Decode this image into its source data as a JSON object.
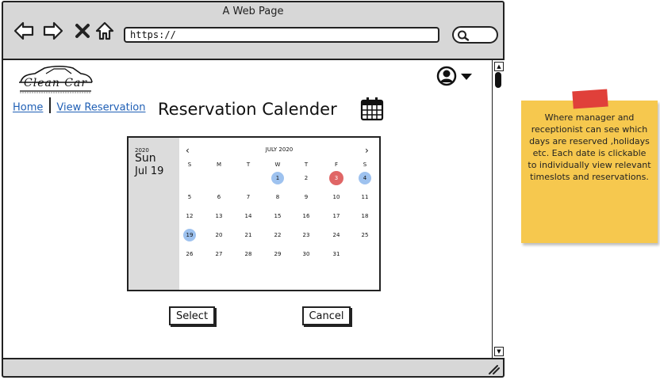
{
  "browser": {
    "title": "A Web Page",
    "url": "https://"
  },
  "icons": {
    "back": "arrow-left-icon",
    "forward": "arrow-right-icon",
    "stop": "close-icon",
    "home": "home-icon",
    "search": "search-icon",
    "user": "user-icon",
    "dropdown": "chevron-down-icon",
    "calendar": "calendar-icon"
  },
  "header": {
    "logo_text": "Clean  Car",
    "nav": {
      "home": "Home",
      "view_reservation": "View Reservation"
    },
    "page_title": "Reservation Calender"
  },
  "calendar": {
    "side": {
      "year": "2020",
      "weekday": "Sun",
      "date": "Jul 19"
    },
    "month_label": "JULY 2020",
    "prev": "‹",
    "next": "›",
    "weekdays": [
      "S",
      "M",
      "T",
      "W",
      "T",
      "F",
      "S"
    ],
    "weeks": [
      [
        "",
        "",
        "",
        "1",
        "2",
        "3",
        "4"
      ],
      [
        "5",
        "6",
        "7",
        "8",
        "9",
        "10",
        "11"
      ],
      [
        "12",
        "13",
        "14",
        "15",
        "16",
        "17",
        "18"
      ],
      [
        "19",
        "20",
        "21",
        "22",
        "23",
        "24",
        "25"
      ],
      [
        "26",
        "27",
        "28",
        "29",
        "30",
        "31",
        ""
      ]
    ],
    "reserved_days": [
      "1",
      "4"
    ],
    "holiday_days": [
      "3"
    ],
    "selected_day": "19",
    "colors": {
      "reserved": "#9ec2ef",
      "holiday": "#e06666",
      "selected": "#9ec2ef",
      "sidebar": "#dcdcdc"
    }
  },
  "actions": {
    "select": "Select",
    "cancel": "Cancel"
  },
  "note": {
    "text": "Where manager and receptionist can see which days are reserved ,holidays etc. Each date is clickable to individually view relevant timeslots and reservations.",
    "colors": {
      "paper": "#f6c84e",
      "tape": "#e0403a"
    }
  }
}
